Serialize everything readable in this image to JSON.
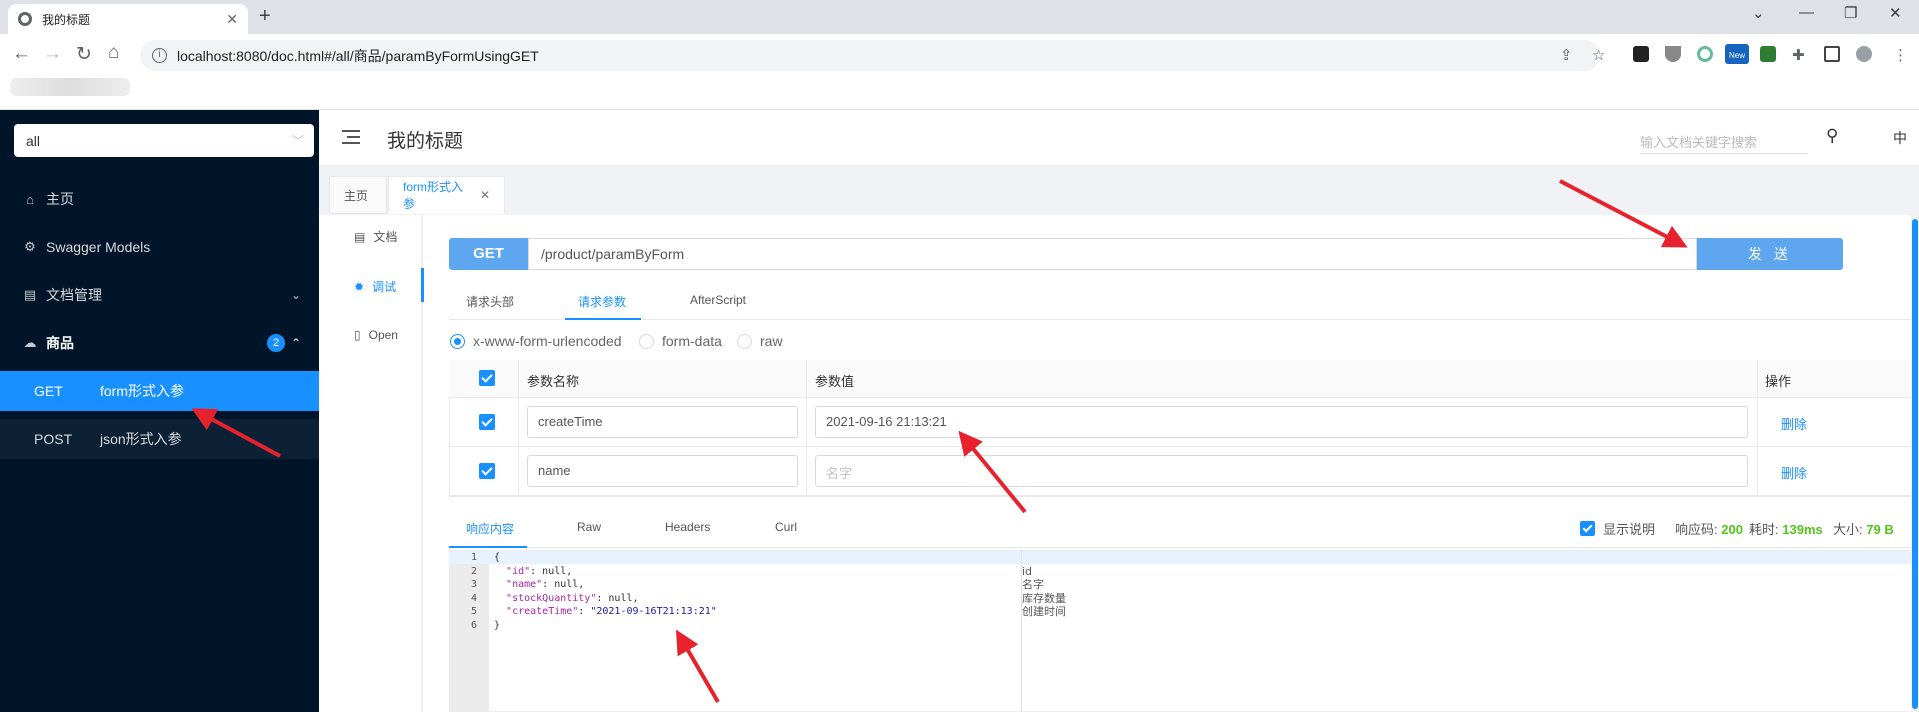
{
  "browser": {
    "tab_title": "我的标题",
    "tab_close": "✕",
    "new_tab": "+",
    "url": "localhost:8080/doc.html#/all/商品/paramByFormUsingGET",
    "new_badge": "New"
  },
  "sidebar": {
    "group_select": "all",
    "items": [
      {
        "label": "主页",
        "icon": "home-icon"
      },
      {
        "label": "Swagger Models",
        "icon": "gear-icon"
      },
      {
        "label": "文档管理",
        "icon": "document-icon"
      },
      {
        "label": "商品",
        "icon": "cloud-icon",
        "badge": "2"
      }
    ],
    "apis": [
      {
        "method": "GET",
        "label": "form形式入参"
      },
      {
        "method": "POST",
        "label": "json形式入参"
      }
    ]
  },
  "header": {
    "title": "我的标题",
    "search_placeholder": "输入文档关键字搜索",
    "lang": "中"
  },
  "doc_tabs": [
    {
      "label": "主页"
    },
    {
      "label": "form形式入参"
    }
  ],
  "side_tabs": [
    {
      "label": "文档"
    },
    {
      "label": "调试"
    },
    {
      "label": "Open"
    }
  ],
  "request": {
    "method": "GET",
    "path": "/product/paramByForm",
    "send_label": "发 送",
    "tabs": [
      "请求头部",
      "请求参数",
      "AfterScript"
    ],
    "content_types": [
      "x-www-form-urlencoded",
      "form-data",
      "raw"
    ],
    "columns": [
      "参数名称",
      "参数值",
      "操作"
    ],
    "params": [
      {
        "name": "createTime",
        "value": "2021-09-16 21:13:21",
        "placeholder": "",
        "action": "删除"
      },
      {
        "name": "name",
        "value": "",
        "placeholder": "名字",
        "action": "删除"
      }
    ]
  },
  "response": {
    "tabs": [
      "响应内容",
      "Raw",
      "Headers",
      "Curl"
    ],
    "show_desc": "显示说明",
    "status_label": "响应码:",
    "status": "200",
    "time_label": "耗时:",
    "time": "139ms",
    "size_label": "大小:",
    "size": "79 B",
    "line_numbers": [
      "1",
      "2",
      "3",
      "4",
      "5",
      "6"
    ],
    "code": {
      "open": "{",
      "l2_key": "\"id\"",
      "l2_rest": ": null,",
      "l3_key": "\"name\"",
      "l3_rest": ": null,",
      "l4_key": "\"stockQuantity\"",
      "l4_rest": ": null,",
      "l5_key": "\"createTime\"",
      "l5_colon": ": ",
      "l5_val": "\"2021-09-16T21:13:21\"",
      "close": "}"
    },
    "descriptions": [
      "id",
      "名字",
      "库存数量",
      "创建时间"
    ]
  },
  "colors": {
    "accent": "#1890ff",
    "sidebar_bg": "#001529",
    "method_bg": "#5ea7f0",
    "annotation_arrow": "#e8222d"
  }
}
